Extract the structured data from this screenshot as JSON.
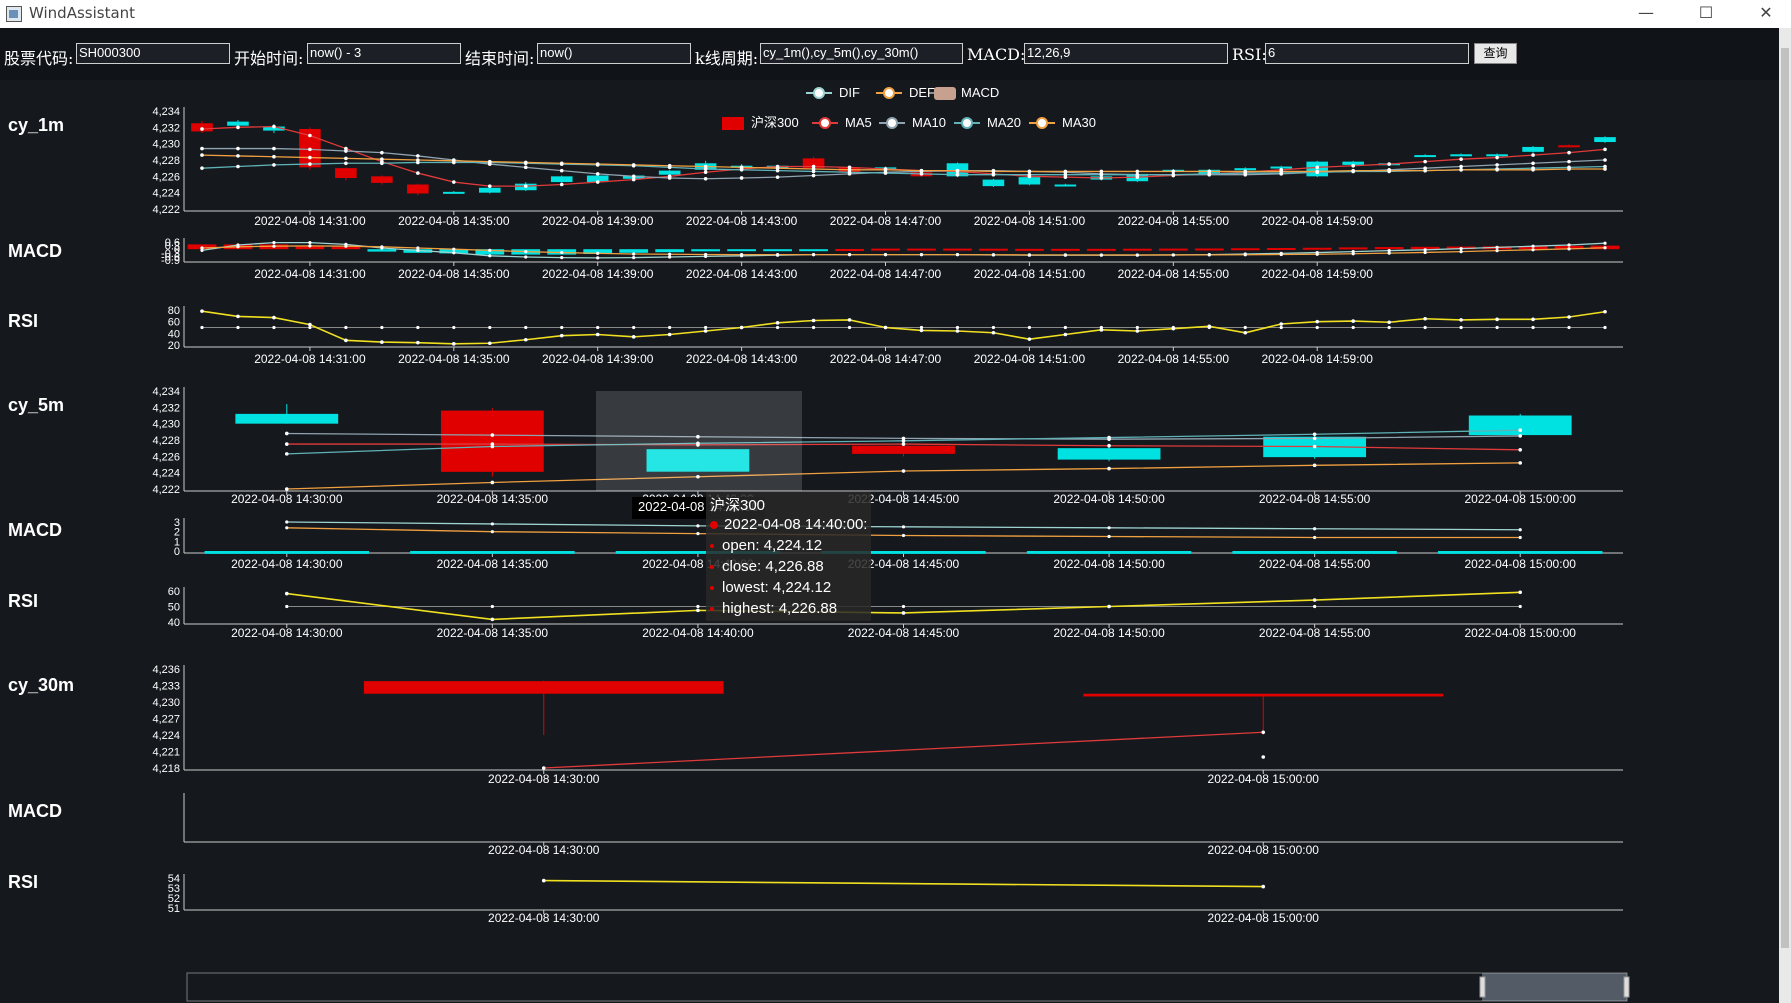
{
  "window": {
    "title": "WindAssistant",
    "minimize_glyph": "—",
    "maximize_glyph": "☐",
    "close_glyph": "✕"
  },
  "form": {
    "stock_code": {
      "label": "股票代码:",
      "value": "SH000300"
    },
    "start_time": {
      "label": "开始时间:",
      "value": "now() - 3"
    },
    "end_time": {
      "label": "结束时间:",
      "value": "now()"
    },
    "kline_period": {
      "label": "k线周期:",
      "value": "cy_1m(),cy_5m(),cy_30m()"
    },
    "macd": {
      "label": "MACD:",
      "value": "12,26,9"
    },
    "rsi": {
      "label": "RSI:",
      "value": "6"
    },
    "query_label": "查询"
  },
  "colors": {
    "background": "#15181d",
    "up": "#e00000",
    "down": "#00e1e1",
    "ma5": "#e03a3a",
    "ma10": "#8fa3b0",
    "ma20": "#5fb3b8",
    "ma30": "#f0a040",
    "dif": "#9dd3d0",
    "dea": "#f0a040",
    "rsi": "#f0e020",
    "axis": "#cccccc"
  },
  "legends": {
    "macd": [
      "DIF",
      "DEF",
      "MACD"
    ],
    "kline": [
      "沪深300",
      "MA5",
      "MA10",
      "MA20",
      "MA30"
    ]
  },
  "chart_data": [
    {
      "type": "candlestick",
      "title": "cy_1m",
      "ylim": [
        4222,
        4234
      ],
      "yticks": [
        "4,234",
        "4,232",
        "4,230",
        "4,228",
        "4,226",
        "4,224",
        "4,222"
      ],
      "xticks": [
        "2022-04-08 14:31:00",
        "2022-04-08 14:35:00",
        "2022-04-08 14:39:00",
        "2022-04-08 14:43:00",
        "2022-04-08 14:47:00",
        "2022-04-08 14:51:00",
        "2022-04-08 14:55:00",
        "2022-04-08 14:59:00"
      ],
      "series_name": "沪深300",
      "candles": [
        [
          4232.5,
          4231.5,
          4232.8,
          4231.3
        ],
        [
          4232.2,
          4232.7,
          4232.9,
          4232.0
        ],
        [
          4231.6,
          4232.1,
          4232.4,
          4231.3
        ],
        [
          4231.8,
          4227.1,
          4232.0,
          4226.8
        ],
        [
          4227.0,
          4225.8,
          4227.1,
          4225.5
        ],
        [
          4226.0,
          4225.2,
          4226.1,
          4225.0
        ],
        [
          4225.0,
          4223.9,
          4225.1,
          4223.7
        ],
        [
          4224.0,
          4224.1,
          4224.2,
          4223.9
        ],
        [
          4224.0,
          4224.6,
          4224.8,
          4223.9
        ],
        [
          4224.3,
          4225.1,
          4225.3,
          4224.2
        ],
        [
          4225.3,
          4226.0,
          4226.1,
          4225.2
        ],
        [
          4225.3,
          4226.1,
          4226.2,
          4225.2
        ],
        [
          4225.7,
          4226.1,
          4226.2,
          4225.6
        ],
        [
          4226.2,
          4226.7,
          4226.8,
          4226.1
        ],
        [
          4226.8,
          4227.6,
          4227.9,
          4226.7
        ],
        [
          4227.2,
          4227.3,
          4227.5,
          4227.1
        ],
        [
          4227.0,
          4227.3,
          4227.4,
          4226.9
        ],
        [
          4228.2,
          4227.0,
          4228.4,
          4226.9
        ],
        [
          4227.1,
          4226.5,
          4227.2,
          4226.3
        ],
        [
          4227.0,
          4227.1,
          4227.2,
          4226.9
        ],
        [
          4226.5,
          4226.0,
          4226.6,
          4225.9
        ],
        [
          4226.0,
          4227.6,
          4227.7,
          4225.9
        ],
        [
          4224.8,
          4225.6,
          4225.7,
          4224.7
        ],
        [
          4225.0,
          4225.9,
          4226.0,
          4224.9
        ],
        [
          4225.0,
          4225.0,
          4225.1,
          4224.9
        ],
        [
          4225.6,
          4226.0,
          4226.1,
          4225.5
        ],
        [
          4225.4,
          4226.3,
          4226.4,
          4225.3
        ],
        [
          4226.7,
          4226.8,
          4226.9,
          4226.6
        ],
        [
          4226.2,
          4226.8,
          4226.9,
          4226.1
        ],
        [
          4227.0,
          4227.0,
          4227.1,
          4226.9
        ],
        [
          4227.0,
          4227.2,
          4227.3,
          4226.9
        ],
        [
          4226.0,
          4227.8,
          4227.9,
          4225.9
        ],
        [
          4227.4,
          4227.8,
          4227.9,
          4227.3
        ],
        [
          4227.5,
          4227.6,
          4227.7,
          4227.4
        ],
        [
          4228.5,
          4228.6,
          4228.7,
          4228.4
        ],
        [
          4228.6,
          4228.7,
          4228.8,
          4228.5
        ],
        [
          4228.6,
          4228.7,
          4228.8,
          4228.5
        ],
        [
          4229.0,
          4229.6,
          4229.7,
          4228.9
        ],
        [
          4229.8,
          4229.7,
          4229.9,
          4229.6
        ],
        [
          4230.2,
          4230.8,
          4230.9,
          4230.1
        ]
      ],
      "ma5": [
        4231.8,
        4232.0,
        4232.1,
        4231.0,
        4229.4,
        4227.8,
        4226.4,
        4225.3,
        4224.8,
        4224.8,
        4225.0,
        4225.3,
        4225.6,
        4226.0,
        4226.5,
        4226.9,
        4227.2,
        4227.2,
        4227.1,
        4226.9,
        4226.7,
        4226.6,
        4226.3,
        4226.0,
        4225.9,
        4225.8,
        4225.9,
        4226.1,
        4226.3,
        4226.5,
        4226.8,
        4227.1,
        4227.3,
        4227.5,
        4227.8,
        4228.1,
        4228.3,
        4228.6,
        4228.9,
        4229.3
      ],
      "ma10": [
        4229.4,
        4229.4,
        4229.4,
        4229.3,
        4229.1,
        4228.9,
        4228.5,
        4228.0,
        4227.5,
        4227.1,
        4226.7,
        4226.3,
        4226.0,
        4225.8,
        4225.7,
        4225.8,
        4225.9,
        4226.1,
        4226.3,
        4226.5,
        4226.6,
        4226.7,
        4226.7,
        4226.6,
        4226.5,
        4226.3,
        4226.2,
        4226.2,
        4226.2,
        4226.2,
        4226.3,
        4226.5,
        4226.6,
        4226.8,
        4227.0,
        4227.2,
        4227.4,
        4227.6,
        4227.8,
        4228.0
      ],
      "ma20": [
        4227.0,
        4227.2,
        4227.4,
        4227.5,
        4227.6,
        4227.6,
        4227.7,
        4227.7,
        4227.7,
        4227.6,
        4227.5,
        4227.4,
        4227.3,
        4227.1,
        4226.9,
        4226.8,
        4226.7,
        4226.6,
        4226.5,
        4226.4,
        4226.3,
        4226.2,
        4226.2,
        4226.2,
        4226.2,
        4226.2,
        4226.2,
        4226.2,
        4226.3,
        4226.4,
        4226.4,
        4226.5,
        4226.6,
        4226.6,
        4226.7,
        4226.8,
        4226.9,
        4227.0,
        4227.1,
        4227.2
      ],
      "ma30": [
        4228.6,
        4228.5,
        4228.4,
        4228.3,
        4228.2,
        4228.1,
        4228.0,
        4227.9,
        4227.8,
        4227.7,
        4227.6,
        4227.5,
        4227.4,
        4227.3,
        4227.2,
        4227.1,
        4227.0,
        4226.9,
        4226.8,
        4226.8,
        4226.7,
        4226.7,
        4226.6,
        4226.6,
        4226.6,
        4226.6,
        4226.6,
        4226.6,
        4226.6,
        4226.6,
        4226.6,
        4226.6,
        4226.7,
        4226.7,
        4226.7,
        4226.8,
        4226.8,
        4226.8,
        4226.9,
        4226.9
      ]
    },
    {
      "type": "macd",
      "title": "MACD",
      "ylim": [
        -0.9,
        0.6
      ],
      "yticks": [
        "0.6",
        "0.3",
        "0",
        "-0.3",
        "-0.6",
        "-0.9"
      ],
      "xticks": [
        "2022-04-08 14:31:00",
        "2022-04-08 14:35:00",
        "2022-04-08 14:39:00",
        "2022-04-08 14:43:00",
        "2022-04-08 14:47:00",
        "2022-04-08 14:51:00",
        "2022-04-08 14:55:00",
        "2022-04-08 14:59:00"
      ],
      "dif": [
        -0.1,
        0.35,
        0.55,
        0.55,
        0.4,
        0.1,
        -0.1,
        -0.3,
        -0.55,
        -0.65,
        -0.7,
        -0.72,
        -0.7,
        -0.65,
        -0.6,
        -0.55,
        -0.5,
        -0.45,
        -0.45,
        -0.45,
        -0.45,
        -0.45,
        -0.48,
        -0.5,
        -0.5,
        -0.5,
        -0.5,
        -0.48,
        -0.45,
        -0.4,
        -0.35,
        -0.28,
        -0.2,
        -0.12,
        -0.05,
        0.05,
        0.15,
        0.25,
        0.35,
        0.5
      ],
      "dea": [
        0.1,
        0.2,
        0.25,
        0.28,
        0.25,
        0.2,
        0.1,
        0.0,
        -0.1,
        -0.2,
        -0.28,
        -0.35,
        -0.4,
        -0.42,
        -0.44,
        -0.45,
        -0.45,
        -0.45,
        -0.45,
        -0.45,
        -0.45,
        -0.45,
        -0.46,
        -0.47,
        -0.47,
        -0.48,
        -0.48,
        -0.48,
        -0.47,
        -0.46,
        -0.44,
        -0.42,
        -0.38,
        -0.33,
        -0.27,
        -0.2,
        -0.12,
        -0.05,
        0.03,
        0.12
      ],
      "hist": [
        0.4,
        0.4,
        0.4,
        0.3,
        0.2,
        -0.2,
        -0.3,
        -0.35,
        -0.45,
        -0.45,
        -0.45,
        -0.4,
        -0.3,
        -0.25,
        -0.18,
        -0.1,
        -0.05,
        -0.02,
        0.02,
        0.05,
        0.05,
        0.05,
        0.04,
        0.03,
        0.03,
        0.03,
        0.04,
        0.05,
        0.06,
        0.08,
        0.1,
        0.12,
        0.15,
        0.18,
        0.2,
        0.22,
        0.24,
        0.26,
        0.28,
        0.3
      ]
    },
    {
      "type": "line",
      "title": "RSI",
      "ylim": [
        20,
        80
      ],
      "yticks": [
        "80",
        "60",
        "40",
        "20"
      ],
      "xticks": [
        "2022-04-08 14:31:00",
        "2022-04-08 14:35:00",
        "2022-04-08 14:39:00",
        "2022-04-08 14:43:00",
        "2022-04-08 14:47:00",
        "2022-04-08 14:51:00",
        "2022-04-08 14:55:00",
        "2022-04-08 14:59:00"
      ],
      "rsi": [
        78,
        69,
        67,
        55,
        28,
        25,
        24,
        22,
        23,
        29,
        36,
        38,
        34,
        38,
        44,
        50,
        58,
        62,
        63,
        50,
        45,
        44,
        41,
        30,
        38,
        46,
        44,
        48,
        52,
        41,
        56,
        60,
        61,
        59,
        65,
        63,
        64,
        64,
        68,
        77
      ],
      "reference": 50
    },
    {
      "type": "candlestick",
      "title": "cy_5m",
      "ylim": [
        4222,
        4234
      ],
      "yticks": [
        "4,234",
        "4,232",
        "4,230",
        "4,228",
        "4,226",
        "4,224",
        "4,222"
      ],
      "xticks": [
        "2022-04-08 14:30:00",
        "2022-04-08 14:35:00",
        "2022-04-08 14:40:00",
        "2022-04-08 14:45:00",
        "2022-04-08 14:50:00",
        "2022-04-08 14:55:00",
        "2022-04-08 15:00:00"
      ],
      "candles": [
        [
          4230.0,
          4231.2,
          4232.4,
          4230.0
        ],
        [
          4231.6,
          4224.1,
          4231.9,
          4223.5
        ],
        [
          4224.12,
          4226.88,
          4226.88,
          4224.12
        ],
        [
          4227.3,
          4226.3,
          4227.7,
          4226.0
        ],
        [
          4225.6,
          4227.0,
          4227.2,
          4225.4
        ],
        [
          4225.9,
          4228.4,
          4228.6,
          4225.7
        ],
        [
          4228.6,
          4231.0,
          4231.2,
          4228.3
        ]
      ],
      "ma5": [
        4227.5,
        4227.5,
        4227.4,
        4227.5,
        4227.3,
        4227.2,
        4226.8
      ],
      "ma10": [
        4228.8,
        4228.6,
        4228.4,
        4228.2,
        4228.1,
        4228.2,
        4228.5
      ],
      "ma20": [
        4226.3,
        4227.2,
        4227.6,
        4227.9,
        4228.3,
        4228.7,
        4229.2
      ],
      "ma30": [
        4222.0,
        4222.8,
        4223.5,
        4224.2,
        4224.5,
        4224.9,
        4225.2
      ]
    },
    {
      "type": "macd",
      "title": "MACD",
      "ylim": [
        0,
        3
      ],
      "yticks": [
        "3",
        "2",
        "1",
        "0"
      ],
      "xticks": [
        "2022-04-08 14:30:00",
        "2022-04-08 14:35:00",
        "2022-04-08 14:40:00",
        "2022-04-08 14:45:00",
        "2022-04-08 14:50:00",
        "2022-04-08 14:55:00",
        "2022-04-08 15:00:00"
      ],
      "dif": [
        3.0,
        2.8,
        2.6,
        2.5,
        2.4,
        2.3,
        2.2
      ],
      "dea": [
        2.4,
        2.0,
        1.8,
        1.6,
        1.5,
        1.4,
        1.4
      ],
      "hist": [
        -0.3,
        -0.3,
        -0.3,
        -0.3,
        -0.3,
        -0.3,
        -0.3
      ]
    },
    {
      "type": "line",
      "title": "RSI",
      "ylim": [
        38,
        62
      ],
      "yticks": [
        "60",
        "50",
        "40"
      ],
      "xticks": [
        "2022-04-08 14:30:00",
        "2022-04-08 14:35:00",
        "2022-04-08 14:40:00",
        "2022-04-08 14:45:00",
        "2022-04-08 14:50:00",
        "2022-04-08 14:55:00",
        "2022-04-08 15:00:00"
      ],
      "rsi": [
        60,
        40,
        47,
        45,
        50,
        55,
        61
      ],
      "reference": 50
    },
    {
      "type": "candlestick",
      "title": "cy_30m",
      "ylim": [
        4218,
        4236
      ],
      "yticks": [
        "4,236",
        "4,233",
        "4,230",
        "4,227",
        "4,224",
        "4,221",
        "4,218"
      ],
      "xticks": [
        "2022-04-08 14:30:00",
        "2022-04-08 15:00:00"
      ],
      "candles": [
        [
          4233.8,
          4231.5,
          4233.9,
          4224.0
        ],
        [
          4231.5,
          4231.0,
          4231.5,
          4224.0
        ]
      ],
      "ma5": [
        4218,
        4224.5
      ],
      "ma10": [
        null,
        4220
      ]
    },
    {
      "type": "macd",
      "title": "MACD",
      "xticks": [
        "2022-04-08 14:30:00",
        "2022-04-08 15:00:00"
      ]
    },
    {
      "type": "line",
      "title": "RSI",
      "ylim": [
        51,
        54.5
      ],
      "yticks": [
        "54",
        "53",
        "52",
        "51"
      ],
      "xticks": [
        "2022-04-08 14:30:00",
        "2022-04-08 15:00:00"
      ],
      "rsi": [
        54.2,
        53.5
      ]
    }
  ],
  "tooltip": {
    "header": "2022-04-08 14:40:00",
    "series": "沪深300",
    "time": "2022-04-08 14:40:00:",
    "open": "open: 4,224.12",
    "close": "close: 4,226.88",
    "lowest": "lowest: 4,224.12",
    "highest": "highest: 4,226.88"
  }
}
